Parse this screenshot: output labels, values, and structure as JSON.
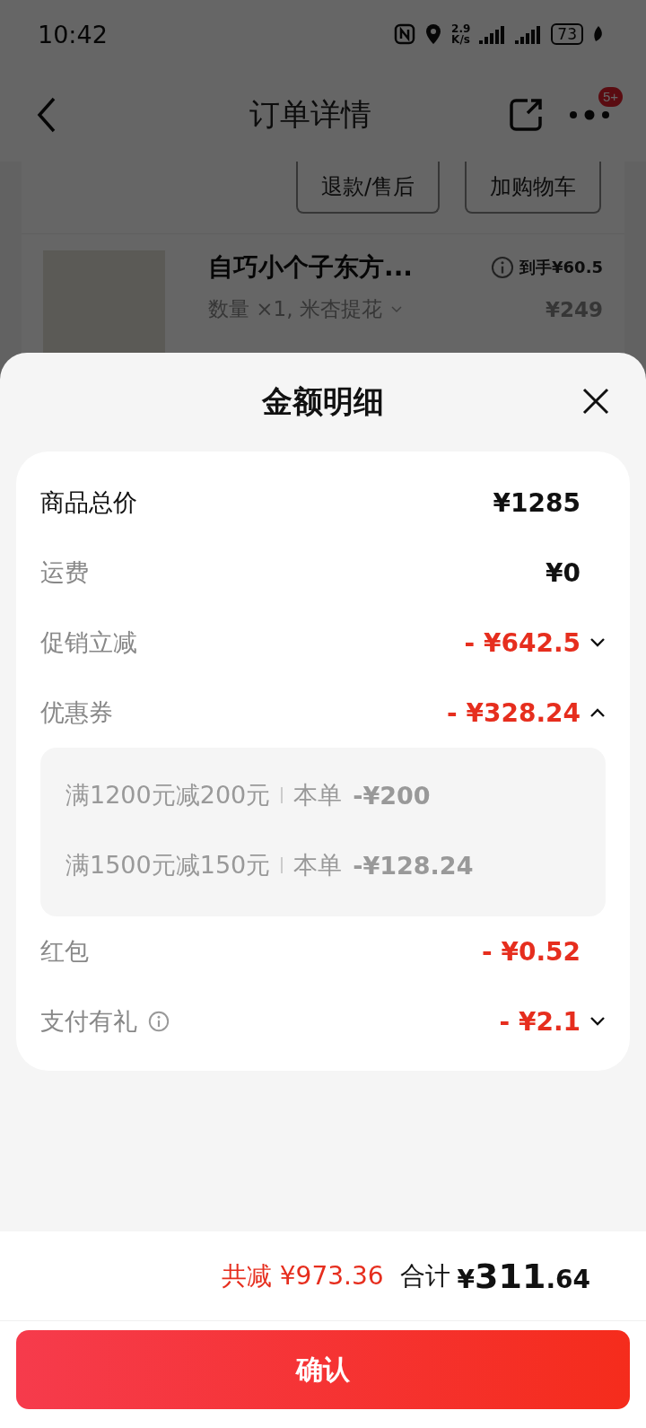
{
  "status_bar": {
    "time": "10:42",
    "speed_value": "2.9",
    "speed_unit": "K/s",
    "battery": "73"
  },
  "nav": {
    "title": "订单详情",
    "badge": "5+"
  },
  "order_actions": [
    "退款/售后",
    "加购物车"
  ],
  "product": {
    "title": "自巧小个子东方...",
    "spec": "数量 ×1, 米杏提花",
    "net_price": "到手¥60.5",
    "price": "¥249"
  },
  "sheet": {
    "title": "金额明细",
    "rows": [
      {
        "kind": "total",
        "label": "商品总价",
        "amount": "¥1285"
      },
      {
        "kind": "fee",
        "label": "运费",
        "amount": "¥0"
      },
      {
        "kind": "discount",
        "label": "促销立减",
        "amount": "- ¥642.5",
        "expanded": false
      },
      {
        "kind": "discount",
        "label": "优惠券",
        "amount": "- ¥328.24",
        "expanded": true,
        "children": [
          {
            "rule": "满1200元减200元",
            "scope": "本单",
            "amount": "-¥200"
          },
          {
            "rule": "满1500元减150元",
            "scope": "本单",
            "amount": "-¥128.24"
          }
        ]
      },
      {
        "kind": "discount",
        "label": "红包",
        "amount": "- ¥0.52"
      },
      {
        "kind": "discount",
        "label": "支付有礼",
        "amount": "- ¥2.1",
        "info": true,
        "expanded": false
      }
    ]
  },
  "summary": {
    "saved_label": "共减",
    "saved_amount": "¥973.36",
    "total_label": "合计",
    "total_currency": "¥",
    "total_integer": "311",
    "total_fraction": ".64"
  },
  "confirm_button": "确认"
}
